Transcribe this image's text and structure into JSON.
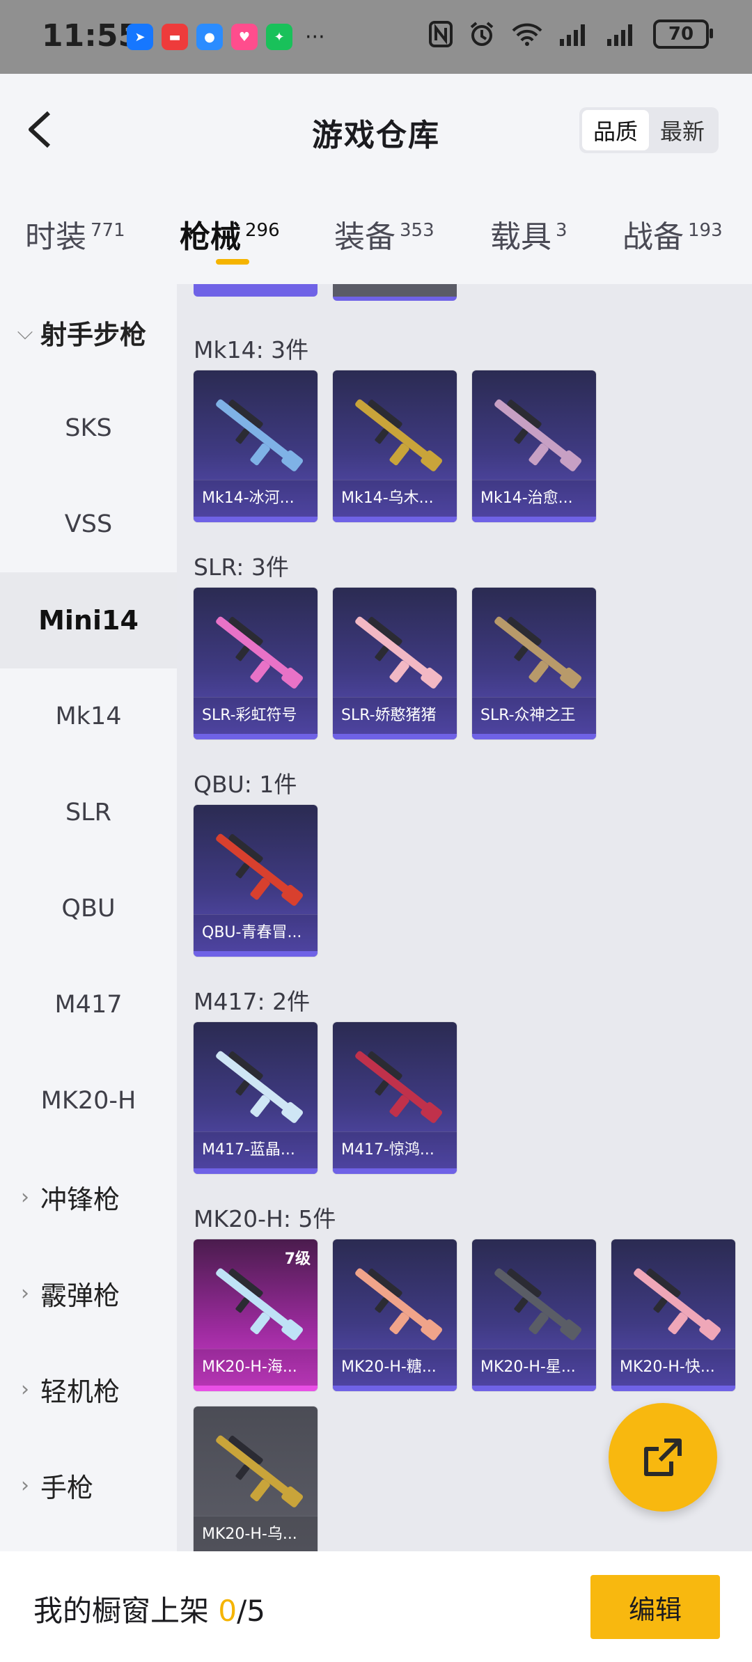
{
  "status_bar": {
    "time": "11:55",
    "battery": "70",
    "app_icons": [
      "maps-icon",
      "red-app-icon",
      "message-icon",
      "pink-app-icon",
      "wechat-icon"
    ],
    "more": "···"
  },
  "header": {
    "title": "游戏仓库",
    "sort_options": [
      "品质",
      "最新"
    ],
    "active_sort": "品质"
  },
  "tabs": [
    {
      "label": "时装",
      "count": "771"
    },
    {
      "label": "枪械",
      "count": "296",
      "active": true
    },
    {
      "label": "装备",
      "count": "353"
    },
    {
      "label": "载具",
      "count": "3"
    },
    {
      "label": "战备",
      "count": "193"
    }
  ],
  "sidebar": {
    "open_group": "射手步枪",
    "sub_items": [
      "SKS",
      "VSS",
      "Mini14",
      "Mk14",
      "SLR",
      "QBU",
      "M417",
      "MK20-H"
    ],
    "active_sub": "Mini14",
    "closed_groups": [
      "冲锋枪",
      "霰弹枪",
      "轻机枪",
      "手枪"
    ]
  },
  "sections": [
    {
      "title": "Mk14: 3件",
      "items": [
        {
          "name": "Mk14-冰河...",
          "color": "#7fb2e6"
        },
        {
          "name": "Mk14-乌木...",
          "color": "#c9a43a"
        },
        {
          "name": "Mk14-治愈...",
          "color": "#c7a0c4"
        }
      ]
    },
    {
      "title": "SLR: 3件",
      "items": [
        {
          "name": "SLR-彩虹符号",
          "color": "#e872c7"
        },
        {
          "name": "SLR-娇憨猪猪",
          "color": "#f2b8c4"
        },
        {
          "name": "SLR-众神之王",
          "color": "#b89a6a"
        }
      ]
    },
    {
      "title": "QBU: 1件",
      "items": [
        {
          "name": "QBU-青春冒...",
          "color": "#d8402e"
        }
      ]
    },
    {
      "title": "M417: 2件",
      "items": [
        {
          "name": "M417-蓝晶...",
          "color": "#cfe6f5"
        },
        {
          "name": "M417-惊鸿...",
          "color": "#c0314b"
        }
      ]
    },
    {
      "title": "MK20-H: 5件",
      "items": [
        {
          "name": "MK20-H-海...",
          "color": "#bfe2f6",
          "level": "7级",
          "pink": true
        },
        {
          "name": "MK20-H-糖...",
          "color": "#f0a48a"
        },
        {
          "name": "MK20-H-星...",
          "color": "#5a5d66"
        },
        {
          "name": "MK20-H-快...",
          "color": "#efa7b8"
        },
        {
          "name": "MK20-H-乌...",
          "color": "#c9a43a",
          "grey": true
        }
      ]
    }
  ],
  "bottom_bar": {
    "showcase_label": "我的橱窗上架",
    "showcase_current": "0",
    "showcase_total": "/5",
    "edit_label": "编辑"
  }
}
